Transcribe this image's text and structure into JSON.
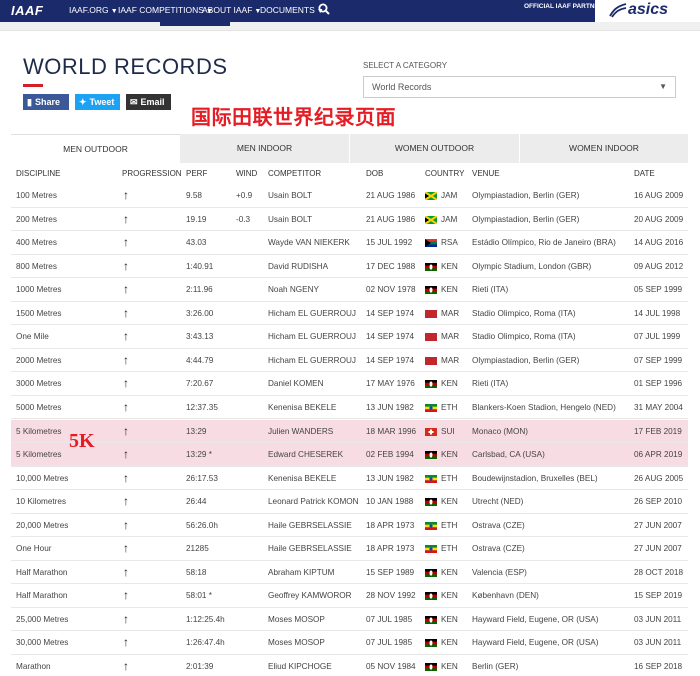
{
  "nav": {
    "logo": "IAAF",
    "items": [
      "IAAF.ORG",
      "IAAF COMPETITIONS",
      "ABOUT IAAF",
      "DOCUMENTS"
    ],
    "partner_label": "OFFICIAL IAAF PARTNER",
    "sponsor": "asics"
  },
  "page": {
    "title": "WORLD RECORDS",
    "share": {
      "facebook": "Share",
      "twitter": "Tweet",
      "email": "Email"
    },
    "category_label": "SELECT A CATEGORY",
    "category_value": "World Records",
    "annotation_cn": "国际田联世界纪录页面",
    "annotation_5k": "5K"
  },
  "tabs": [
    "MEN OUTDOOR",
    "MEN INDOOR",
    "WOMEN OUTDOOR",
    "WOMEN INDOOR"
  ],
  "active_tab": "MEN OUTDOOR",
  "columns": [
    "DISCIPLINE",
    "PROGRESSION",
    "PERF",
    "WIND",
    "COMPETITOR",
    "DOB",
    "COUNTRY",
    "VENUE",
    "DATE"
  ],
  "progression_symbol": "↑",
  "records": [
    {
      "discipline": "100 Metres",
      "perf": "9.58",
      "wind": "+0.9",
      "competitor": "Usain BOLT",
      "dob": "21 AUG 1986",
      "country": "JAM",
      "venue": "Olympiastadion, Berlin (GER)",
      "date": "16 AUG 2009",
      "highlight": false
    },
    {
      "discipline": "200 Metres",
      "perf": "19.19",
      "wind": "-0.3",
      "competitor": "Usain BOLT",
      "dob": "21 AUG 1986",
      "country": "JAM",
      "venue": "Olympiastadion, Berlin (GER)",
      "date": "20 AUG 2009",
      "highlight": false
    },
    {
      "discipline": "400 Metres",
      "perf": "43.03",
      "wind": "",
      "competitor": "Wayde VAN NIEKERK",
      "dob": "15 JUL 1992",
      "country": "RSA",
      "venue": "Estádio Olímpico, Rio de Janeiro (BRA)",
      "date": "14 AUG 2016",
      "highlight": false
    },
    {
      "discipline": "800 Metres",
      "perf": "1:40.91",
      "wind": "",
      "competitor": "David RUDISHA",
      "dob": "17 DEC 1988",
      "country": "KEN",
      "venue": "Olympic Stadium, London (GBR)",
      "date": "09 AUG 2012",
      "highlight": false
    },
    {
      "discipline": "1000 Metres",
      "perf": "2:11.96",
      "wind": "",
      "competitor": "Noah NGENY",
      "dob": "02 NOV 1978",
      "country": "KEN",
      "venue": "Rieti (ITA)",
      "date": "05 SEP 1999",
      "highlight": false
    },
    {
      "discipline": "1500 Metres",
      "perf": "3:26.00",
      "wind": "",
      "competitor": "Hicham EL GUERROUJ",
      "dob": "14 SEP 1974",
      "country": "MAR",
      "venue": "Stadio Olimpico, Roma (ITA)",
      "date": "14 JUL 1998",
      "highlight": false
    },
    {
      "discipline": "One Mile",
      "perf": "3:43.13",
      "wind": "",
      "competitor": "Hicham EL GUERROUJ",
      "dob": "14 SEP 1974",
      "country": "MAR",
      "venue": "Stadio Olimpico, Roma (ITA)",
      "date": "07 JUL 1999",
      "highlight": false
    },
    {
      "discipline": "2000 Metres",
      "perf": "4:44.79",
      "wind": "",
      "competitor": "Hicham EL GUERROUJ",
      "dob": "14 SEP 1974",
      "country": "MAR",
      "venue": "Olympiastadion, Berlin (GER)",
      "date": "07 SEP 1999",
      "highlight": false
    },
    {
      "discipline": "3000 Metres",
      "perf": "7:20.67",
      "wind": "",
      "competitor": "Daniel KOMEN",
      "dob": "17 MAY 1976",
      "country": "KEN",
      "venue": "Rieti (ITA)",
      "date": "01 SEP 1996",
      "highlight": false
    },
    {
      "discipline": "5000 Metres",
      "perf": "12:37.35",
      "wind": "",
      "competitor": "Kenenisa BEKELE",
      "dob": "13 JUN 1982",
      "country": "ETH",
      "venue": "Blankers-Koen Stadion, Hengelo (NED)",
      "date": "31 MAY 2004",
      "highlight": false
    },
    {
      "discipline": "5 Kilometres",
      "perf": "13:29",
      "wind": "",
      "competitor": "Julien WANDERS",
      "dob": "18 MAR 1996",
      "country": "SUI",
      "venue": "Monaco (MON)",
      "date": "17 FEB 2019",
      "highlight": true
    },
    {
      "discipline": "5 Kilometres",
      "perf": "13:29 *",
      "wind": "",
      "competitor": "Edward CHESEREK",
      "dob": "02 FEB 1994",
      "country": "KEN",
      "venue": "Carlsbad, CA (USA)",
      "date": "06 APR 2019",
      "highlight": true
    },
    {
      "discipline": "10,000 Metres",
      "perf": "26:17.53",
      "wind": "",
      "competitor": "Kenenisa BEKELE",
      "dob": "13 JUN 1982",
      "country": "ETH",
      "venue": "Boudewijnstadion, Bruxelles (BEL)",
      "date": "26 AUG 2005",
      "highlight": false
    },
    {
      "discipline": "10 Kilometres",
      "perf": "26:44",
      "wind": "",
      "competitor": "Leonard Patrick KOMON",
      "dob": "10 JAN 1988",
      "country": "KEN",
      "venue": "Utrecht (NED)",
      "date": "26 SEP 2010",
      "highlight": false
    },
    {
      "discipline": "20,000 Metres",
      "perf": "56:26.0h",
      "wind": "",
      "competitor": "Haile GEBRSELASSIE",
      "dob": "18 APR 1973",
      "country": "ETH",
      "venue": "Ostrava (CZE)",
      "date": "27 JUN 2007",
      "highlight": false
    },
    {
      "discipline": "One Hour",
      "perf": "21285",
      "wind": "",
      "competitor": "Haile GEBRSELASSIE",
      "dob": "18 APR 1973",
      "country": "ETH",
      "venue": "Ostrava (CZE)",
      "date": "27 JUN 2007",
      "highlight": false
    },
    {
      "discipline": "Half Marathon",
      "perf": "58:18",
      "wind": "",
      "competitor": "Abraham KIPTUM",
      "dob": "15 SEP 1989",
      "country": "KEN",
      "venue": "Valencia (ESP)",
      "date": "28 OCT 2018",
      "highlight": false
    },
    {
      "discipline": "Half Marathon",
      "perf": "58:01 *",
      "wind": "",
      "competitor": "Geoffrey KAMWOROR",
      "dob": "28 NOV 1992",
      "country": "KEN",
      "venue": "København (DEN)",
      "date": "15 SEP 2019",
      "highlight": false
    },
    {
      "discipline": "25,000 Metres",
      "perf": "1:12:25.4h",
      "wind": "",
      "competitor": "Moses MOSOP",
      "dob": "07 JUL 1985",
      "country": "KEN",
      "venue": "Hayward Field, Eugene, OR (USA)",
      "date": "03 JUN 2011",
      "highlight": false
    },
    {
      "discipline": "30,000 Metres",
      "perf": "1:26:47.4h",
      "wind": "",
      "competitor": "Moses MOSOP",
      "dob": "07 JUL 1985",
      "country": "KEN",
      "venue": "Hayward Field, Eugene, OR (USA)",
      "date": "03 JUN 2011",
      "highlight": false
    },
    {
      "discipline": "Marathon",
      "perf": "2:01:39",
      "wind": "",
      "competitor": "Eliud KIPCHOGE",
      "dob": "05 NOV 1984",
      "country": "KEN",
      "venue": "Berlin (GER)",
      "date": "16 SEP 2018",
      "highlight": false
    }
  ],
  "colors": {
    "nav": "#1b2a6b",
    "annotation": "#e51c24",
    "highlight": "#f7dde3"
  }
}
